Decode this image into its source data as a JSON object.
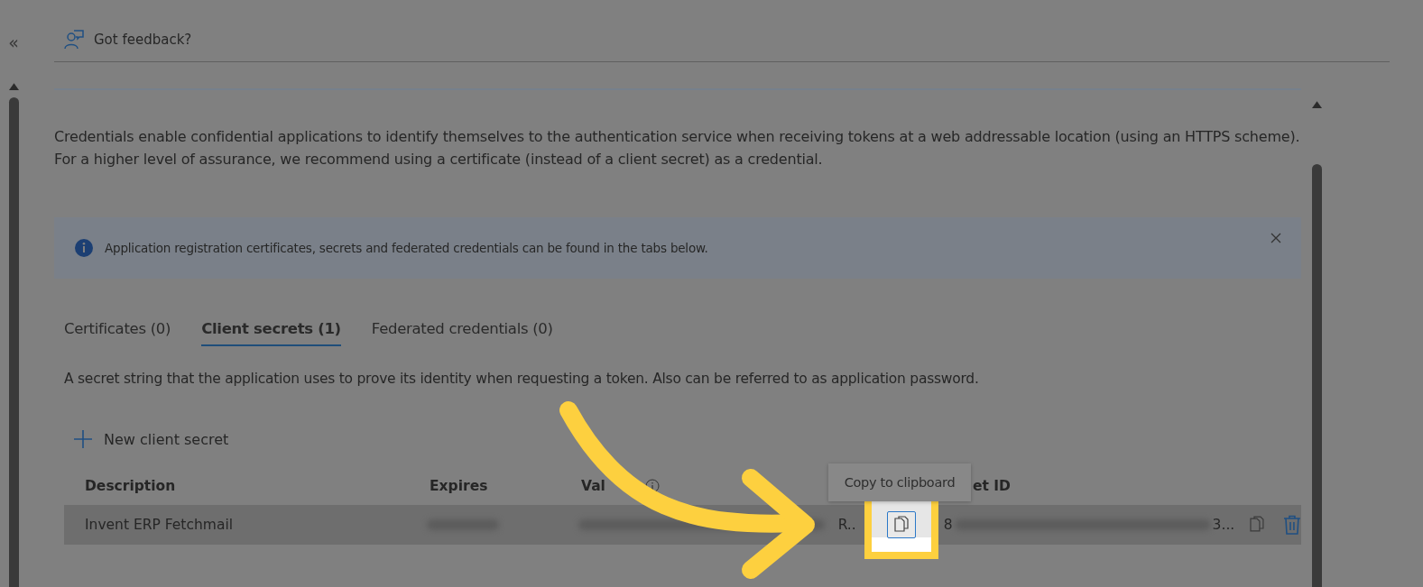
{
  "sidebar": {
    "collapse_glyph": "«"
  },
  "toolbar": {
    "feedback": "Got feedback?"
  },
  "intro": "Credentials enable confidential applications to identify themselves to the authentication service when receiving tokens at a web addressable location (using an HTTPS scheme). For a higher level of assurance, we recommend using a certificate (instead of a client secret) as a credential.",
  "info_bar": {
    "message": "Application registration certificates, secrets and federated credentials can be found in the tabs below."
  },
  "tabs": [
    {
      "label": "Certificates (0)",
      "selected": false
    },
    {
      "label": "Client secrets (1)",
      "selected": true
    },
    {
      "label": "Federated credentials (0)",
      "selected": false
    }
  ],
  "tab_description": "A secret string that the application uses to prove its identity when requesting a token. Also can be referred to as application password.",
  "new_secret_button": "New client secret",
  "table": {
    "columns": [
      "Description",
      "Expires",
      "Val",
      "et ID"
    ],
    "rows": [
      {
        "description": "Invent ERP Fetchmail",
        "value": "R..",
        "secret_id_start": "8",
        "secret_id_end": "3...",
        "selected": true
      }
    ]
  },
  "tooltip": "Copy to clipboard"
}
